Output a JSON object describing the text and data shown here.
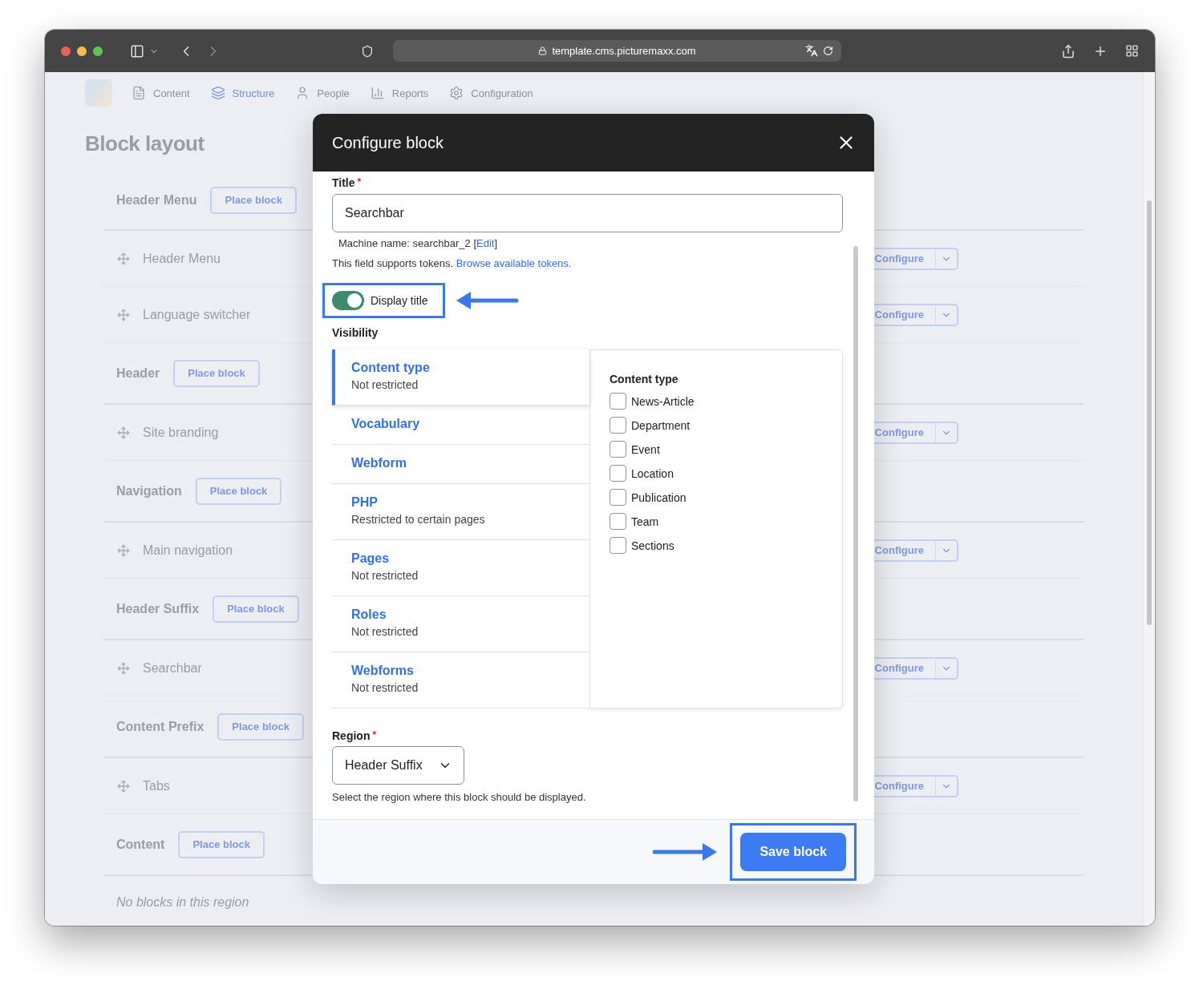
{
  "browser": {
    "url": "template.cms.picturemaxx.com"
  },
  "nav": {
    "items": [
      {
        "label": "Content",
        "selected": false
      },
      {
        "label": "Structure",
        "selected": true
      },
      {
        "label": "People",
        "selected": false
      },
      {
        "label": "Reports",
        "selected": false
      },
      {
        "label": "Configuration",
        "selected": false
      }
    ]
  },
  "page": {
    "title": "Block layout",
    "regions": [
      {
        "name": "Header Menu",
        "place_label": "Place block",
        "blocks": [
          {
            "name": "Header Menu",
            "configure": "Configure"
          },
          {
            "name": "Language switcher",
            "configure": "Configure"
          }
        ]
      },
      {
        "name": "Header",
        "place_label": "Place block",
        "blocks": [
          {
            "name": "Site branding",
            "configure": "Configure"
          }
        ]
      },
      {
        "name": "Navigation",
        "place_label": "Place block",
        "blocks": [
          {
            "name": "Main navigation",
            "configure": "Configure"
          }
        ]
      },
      {
        "name": "Header Suffix",
        "place_label": "Place block",
        "blocks": [
          {
            "name": "Searchbar",
            "configure": "Configure"
          }
        ]
      },
      {
        "name": "Content Prefix",
        "place_label": "Place block",
        "blocks": [
          {
            "name": "Tabs",
            "configure": "Configure"
          }
        ]
      },
      {
        "name": "Content",
        "place_label": "Place block",
        "empty_text": "No blocks in this region"
      }
    ]
  },
  "modal": {
    "title": "Configure block",
    "title_field": {
      "label": "Title",
      "required_mark": "*",
      "value": "Searchbar"
    },
    "machine_name": {
      "text": "Machine name: searchbar_2",
      "bracket_open": "[",
      "link": "Edit",
      "bracket_close": "]"
    },
    "tokens": {
      "text": "This field supports tokens.",
      "link": "Browse available tokens."
    },
    "display_title": {
      "label": "Display title",
      "on": true,
      "highlighted": true
    },
    "visibility": {
      "heading": "Visibility",
      "tabs": [
        {
          "title": "Content type",
          "summary": "Not restricted",
          "selected": true
        },
        {
          "title": "Vocabulary",
          "selected": false
        },
        {
          "title": "Webform",
          "selected": false
        },
        {
          "title": "PHP",
          "summary": "Restricted to certain pages",
          "selected": false
        },
        {
          "title": "Pages",
          "summary": "Not restricted",
          "selected": false
        },
        {
          "title": "Roles",
          "summary": "Not restricted",
          "selected": false
        },
        {
          "title": "Webforms",
          "summary": "Not restricted",
          "selected": false
        }
      ],
      "pane": {
        "heading": "Content type",
        "options": [
          {
            "label": "News-Article",
            "checked": false
          },
          {
            "label": "Department",
            "checked": false
          },
          {
            "label": "Event",
            "checked": false
          },
          {
            "label": "Location",
            "checked": false
          },
          {
            "label": "Publication",
            "checked": false
          },
          {
            "label": "Team",
            "checked": false
          },
          {
            "label": "Sections",
            "checked": false
          }
        ]
      }
    },
    "region": {
      "label": "Region",
      "required_mark": "*",
      "value": "Header Suffix",
      "description": "Select the region where this block should be displayed."
    },
    "save": {
      "label": "Save block",
      "highlighted": true
    }
  }
}
